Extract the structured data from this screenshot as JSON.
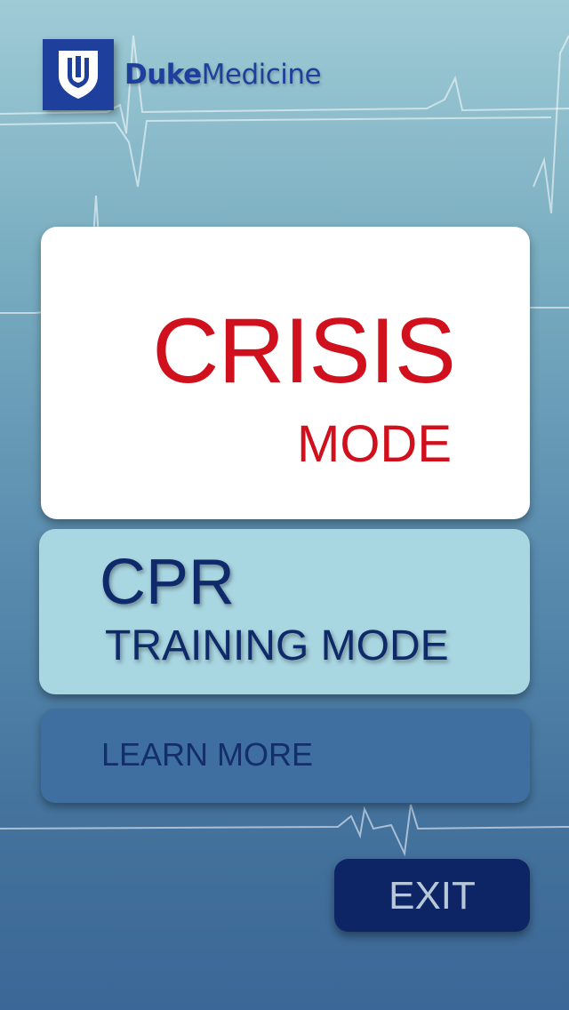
{
  "logo": {
    "icon": "duke-shield-icon",
    "text_bold": "Duke",
    "text_regular": "Medicine"
  },
  "buttons": {
    "crisis": {
      "title": "CRISIS",
      "subtitle": "MODE"
    },
    "cpr": {
      "title": "CPR",
      "subtitle": "TRAINING MODE"
    },
    "learn_more": {
      "label": "LEARN MORE"
    },
    "exit": {
      "label": "EXIT"
    }
  },
  "colors": {
    "brand_blue": "#1f3f9c",
    "crisis_red": "#d0101d",
    "navy": "#0e2565",
    "cpr_bg": "#a8d6e1"
  }
}
